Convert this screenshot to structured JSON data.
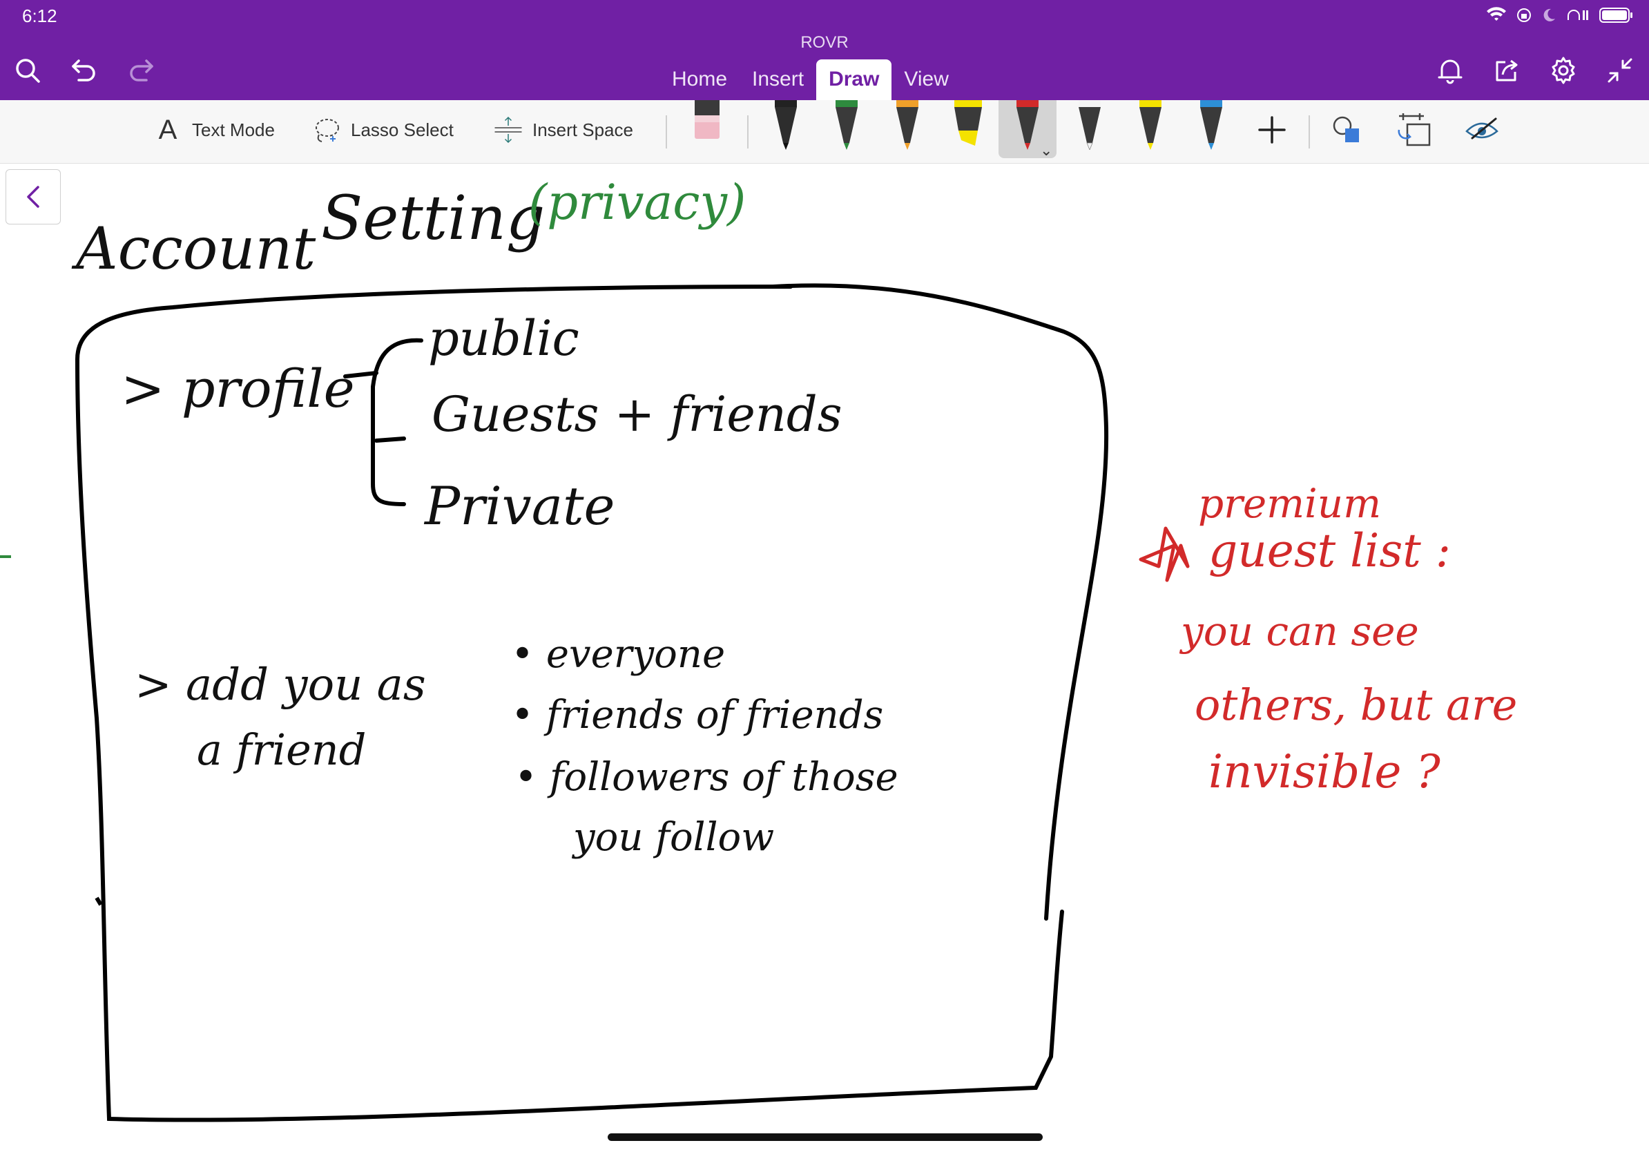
{
  "status": {
    "time": "6:12"
  },
  "app": {
    "title": "ROVR"
  },
  "tabs": [
    {
      "label": "Home"
    },
    {
      "label": "Insert"
    },
    {
      "label": "Draw"
    },
    {
      "label": "View"
    }
  ],
  "ribbon": {
    "text_mode": "Text Mode",
    "lasso_select": "Lasso Select",
    "insert_space": "Insert Space"
  },
  "pens": [
    {
      "name": "eraser-pink",
      "color": "#f0b8c4"
    },
    {
      "name": "pen-black",
      "color": "#111111"
    },
    {
      "name": "pen-green",
      "color": "#2e8b3e"
    },
    {
      "name": "pencil-orange",
      "color": "#f0a02a"
    },
    {
      "name": "highlighter-yellow",
      "color": "#f4e200"
    },
    {
      "name": "pen-red",
      "color": "#d22a2a",
      "selected": true
    },
    {
      "name": "pen-white",
      "color": "#f4f4f4"
    },
    {
      "name": "pen-yellow",
      "color": "#f4e200"
    },
    {
      "name": "pen-blue",
      "color": "#2d8fd6"
    }
  ],
  "ink": {
    "account": "Account",
    "setting": "Setting",
    "privacy": "(privacy)",
    "profile": "> profile",
    "public": "public",
    "guests_friends": "Guests + friends",
    "private": "Private",
    "add_you_as": "> add   you   as",
    "a_friend": "a    friend",
    "everyone": "• everyone",
    "friends_of_friends": "• friends   of   friends",
    "followers": "• followers   of   those",
    "you_follow": "you      follow",
    "premium": "premium",
    "guest_list": "guest list :",
    "you_can_see": "you  can  see",
    "others_but_are": "others, but are",
    "invisible": "invisible ?"
  }
}
